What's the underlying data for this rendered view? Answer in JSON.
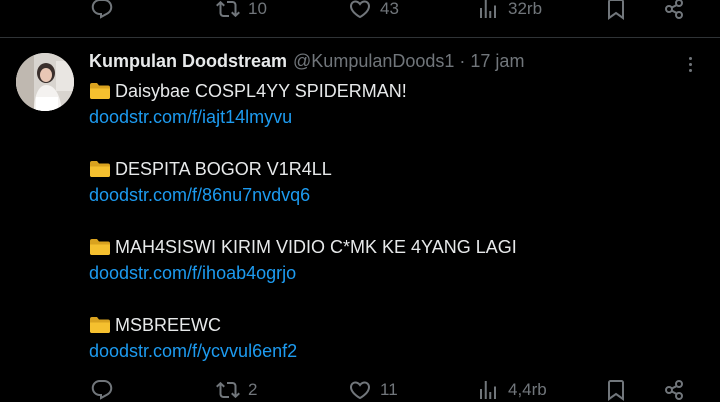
{
  "previous_tweet_actions": {
    "replies": "",
    "retweets": "10",
    "likes": "43",
    "views": "32rb"
  },
  "tweet": {
    "display_name": "Kumpulan Doodstream",
    "handle": "@KumpulanDoods1",
    "separator": "·",
    "time": "17 jam",
    "entries": [
      {
        "title": "Daisybae COSPL4YY SPIDERMAN!",
        "link": "doodstr.com/f/iajt14lmyvu"
      },
      {
        "title": "DESPITA BOGOR V1R4LL",
        "link": "doodstr.com/f/86nu7nvdvq6"
      },
      {
        "title": "MAH4SISWI KIRIM VIDIO C*MK KE 4YANG LAGI",
        "link": "doodstr.com/f/ihoab4ogrjo"
      },
      {
        "title": "MSBREEWC",
        "link": "doodstr.com/f/ycvvul6enf2"
      }
    ],
    "actions": {
      "replies": "",
      "retweets": "2",
      "likes": "11",
      "views": "4,4rb"
    }
  },
  "icons": {
    "entry_prefix": "folder-icon",
    "folder_color": "#f5c02f"
  },
  "colors": {
    "background": "#000000",
    "text": "#e7e9ea",
    "muted": "#71767b",
    "link": "#1d9bf0",
    "divider": "#2f3336"
  }
}
